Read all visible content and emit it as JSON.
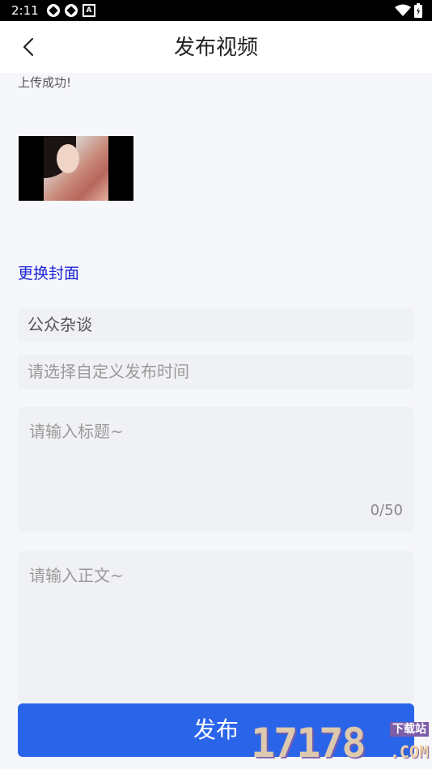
{
  "status_bar": {
    "time": "2:11",
    "left_icons": [
      "sync-icon",
      "sync-icon",
      "a-icon"
    ],
    "right_icons": [
      "wifi-icon",
      "battery-icon"
    ]
  },
  "header": {
    "title": "发布视频",
    "back_icon": "chevron-left-icon"
  },
  "upload": {
    "status_text": "上传成功!",
    "change_cover_label": "更换封面"
  },
  "form": {
    "category_value": "公众杂谈",
    "time_placeholder": "请选择自定义发布时间",
    "title_placeholder": "请输入标题~",
    "title_count": "0/50",
    "body_placeholder": "请输入正文~"
  },
  "actions": {
    "publish_label": "发布"
  },
  "watermark": {
    "digits": "17178",
    "sub": "下载站",
    "com": ".COM"
  },
  "colors": {
    "accent": "#2a64e8",
    "link": "#1a22d6",
    "field_bg": "#f0f1f4",
    "page_bg": "#f6f7fb"
  }
}
